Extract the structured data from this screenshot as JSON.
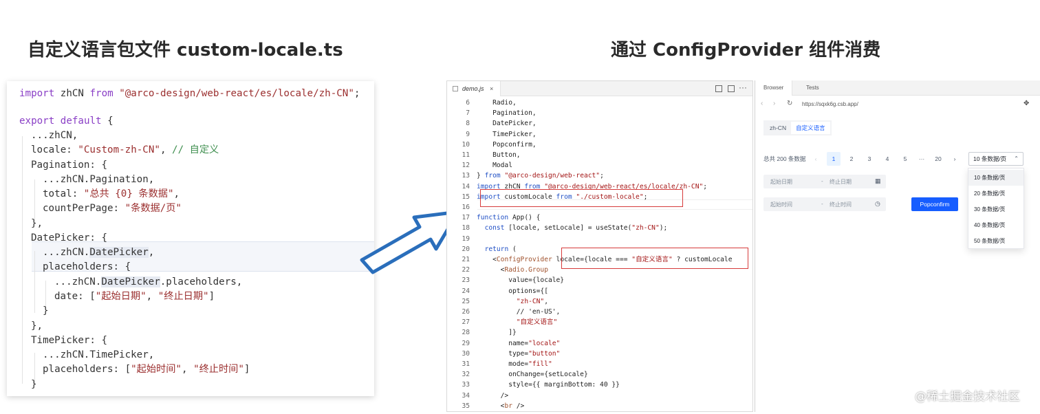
{
  "headings": {
    "left": "自定义语言包文件 custom-locale.ts",
    "right": "通过 ConfigProvider 组件消费"
  },
  "left_code": {
    "l1_kw": "import",
    "l1_mid": " zhCN ",
    "l1_kw2": "from",
    "l1_str": " \"@arco-design/web-react/es/locale/zh-CN\"",
    "l1_end": ";",
    "l2_kw": "export default",
    "l2_end": " {",
    "l3": "...zhCN,",
    "l4_a": "locale: ",
    "l4_str": "\"Custom-zh-CN\"",
    "l4_b": ", ",
    "l4_cmt": "// 自定义",
    "l5": "Pagination: {",
    "l6": "...zhCN.Pagination,",
    "l7_a": "total: ",
    "l7_str": "\"总共 {0} 条数据\"",
    "l7_b": ",",
    "l8_a": "countPerPage: ",
    "l8_str": "\"条数据/页\"",
    "l9": "},",
    "l10": "DatePicker: {",
    "l11_a": "...zhCN.",
    "l11_hl": "DatePicker",
    "l11_b": ",",
    "l12": "placeholders: {",
    "l13_a": "...zhCN.",
    "l13_hl": "DatePicker",
    "l13_b": ".placeholders,",
    "l14_a": "date: [",
    "l14_s1": "\"起始日期\"",
    "l14_b": ", ",
    "l14_s2": "\"终止日期\"",
    "l14_c": "]",
    "l15": "}",
    "l16": "},",
    "l17": "TimePicker: {",
    "l18": "...zhCN.TimePicker,",
    "l19_a": "placeholders: [",
    "l19_s1": "\"起始时间\"",
    "l19_b": ", ",
    "l19_s2": "\"终止时间\"",
    "l19_c": "]",
    "l20": "}"
  },
  "editor": {
    "tab_label": "demo.js",
    "tab_close": "×",
    "more_icon": "···",
    "lines": [
      {
        "n": "6",
        "t": "    Radio,"
      },
      {
        "n": "7",
        "t": "    Pagination,"
      },
      {
        "n": "8",
        "t": "    DatePicker,"
      },
      {
        "n": "9",
        "t": "    TimePicker,"
      },
      {
        "n": "10",
        "t": "    Popconfirm,"
      },
      {
        "n": "11",
        "t": "    Button,"
      },
      {
        "n": "12",
        "t": "    Modal"
      },
      {
        "n": "13",
        "t": "} from \"@arco-design/web-react\";"
      },
      {
        "n": "14",
        "t": "import zhCN from \"@arco-design/web-react/es/locale/zh-CN\";"
      },
      {
        "n": "15",
        "t": "import customLocale from \"./custom-locale\";"
      },
      {
        "n": "16",
        "t": ""
      },
      {
        "n": "17",
        "t": "function App() {"
      },
      {
        "n": "18",
        "t": "  const [locale, setLocale] = useState(\"zh-CN\");"
      },
      {
        "n": "19",
        "t": ""
      },
      {
        "n": "20",
        "t": "  return ("
      },
      {
        "n": "21",
        "t": "    <ConfigProvider locale={locale === \"自定义语言\" ? customLocale"
      },
      {
        "n": "22",
        "t": "      <Radio.Group"
      },
      {
        "n": "23",
        "t": "        value={locale}"
      },
      {
        "n": "24",
        "t": "        options={["
      },
      {
        "n": "25",
        "t": "          \"zh-CN\","
      },
      {
        "n": "26",
        "t": "          // 'en-US',"
      },
      {
        "n": "27",
        "t": "          \"自定义语言\""
      },
      {
        "n": "28",
        "t": "        ]}"
      },
      {
        "n": "29",
        "t": "        name=\"locale\""
      },
      {
        "n": "30",
        "t": "        type=\"button\""
      },
      {
        "n": "31",
        "t": "        mode=\"fill\""
      },
      {
        "n": "32",
        "t": "        onChange={setLocale}"
      },
      {
        "n": "33",
        "t": "        style={{ marginBottom: 40 }}"
      },
      {
        "n": "34",
        "t": "      />"
      },
      {
        "n": "35",
        "t": "      <br />"
      }
    ]
  },
  "browser": {
    "tab_browser": "Browser",
    "tab_tests": "Tests",
    "url": "https://sqxk6g.csb.app/",
    "back": "‹",
    "forward": "›",
    "refresh": "↻",
    "expand": "✥",
    "radio": [
      "zh-CN",
      "自定义语言"
    ],
    "pagination": {
      "total": "总共 200 条数据",
      "prev": "‹",
      "pages": [
        "1",
        "2",
        "3",
        "4",
        "5",
        "···",
        "20"
      ],
      "next": "›",
      "page_size": "10 条数据/页",
      "caret": "⌃"
    },
    "page_size_options": [
      "10 条数据/页",
      "20 条数据/页",
      "30 条数据/页",
      "40 条数据/页",
      "50 条数据/页"
    ],
    "date_picker": {
      "start": "起始日期",
      "sep": "-",
      "end": "终止日期",
      "icon": "▦"
    },
    "time_picker": {
      "start": "起始时间",
      "sep": "-",
      "end": "终止时间",
      "icon": "◷"
    },
    "popconfirm": "Popconfirm"
  },
  "watermark": "@稀土掘金技术社区",
  "colors": {
    "accent": "#165dff",
    "highlight_box": "#d63a3a",
    "arrow": "#2a6ebb"
  }
}
